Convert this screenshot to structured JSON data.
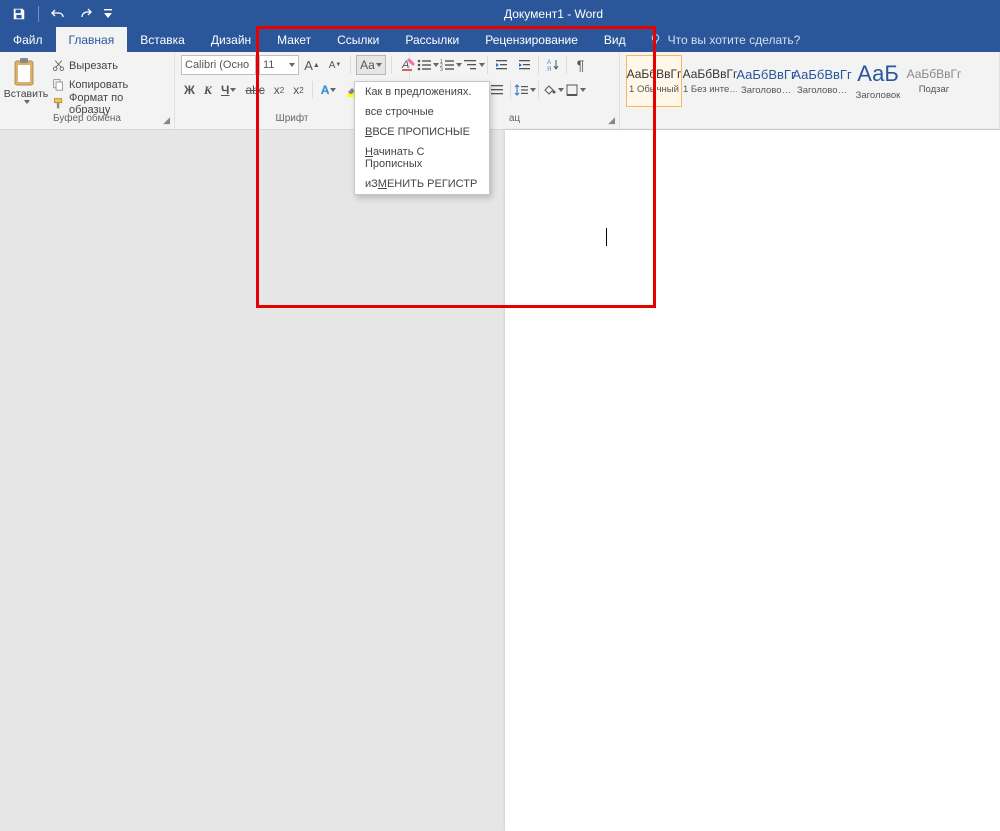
{
  "title": "Документ1 - Word",
  "tabs": {
    "file": "Файл",
    "home": "Главная",
    "insert": "Вставка",
    "design": "Дизайн",
    "layout": "Макет",
    "references": "Ссылки",
    "mailings": "Рассылки",
    "review": "Рецензирование",
    "view": "Вид"
  },
  "tellme": "Что вы хотите сделать?",
  "clipboard": {
    "paste": "Вставить",
    "cut": "Вырезать",
    "copy": "Копировать",
    "painter": "Формат по образцу",
    "group": "Буфер обмена"
  },
  "font": {
    "name": "Calibri (Осно",
    "size": "11",
    "group": "Шрифт",
    "bold": "Ж",
    "italic": "К",
    "underline": "Ч",
    "strike": "abc"
  },
  "paragraph": {
    "group": "ац"
  },
  "change_case": {
    "sentence": "Как в предложениях.",
    "lower": "все строчные",
    "upper_pre": "ВСЕ ПРОПИСНЫЕ",
    "upper_u": "В",
    "capitalize_pre": "ачинать С Прописных",
    "capitalize_u": "Н",
    "toggle_pre": "иЗ",
    "toggle_u": "М",
    "toggle_post": "ЕНИТЬ РЕГИСТР"
  },
  "styles": {
    "preview": "АаБбВвГг",
    "preview_title": "АаБ",
    "names": {
      "normal": "1 Обычный",
      "nospace": "1 Без инте…",
      "h1": "Заголово…",
      "h2": "Заголово…",
      "title": "Заголовок",
      "sub": "Подзаг"
    }
  }
}
